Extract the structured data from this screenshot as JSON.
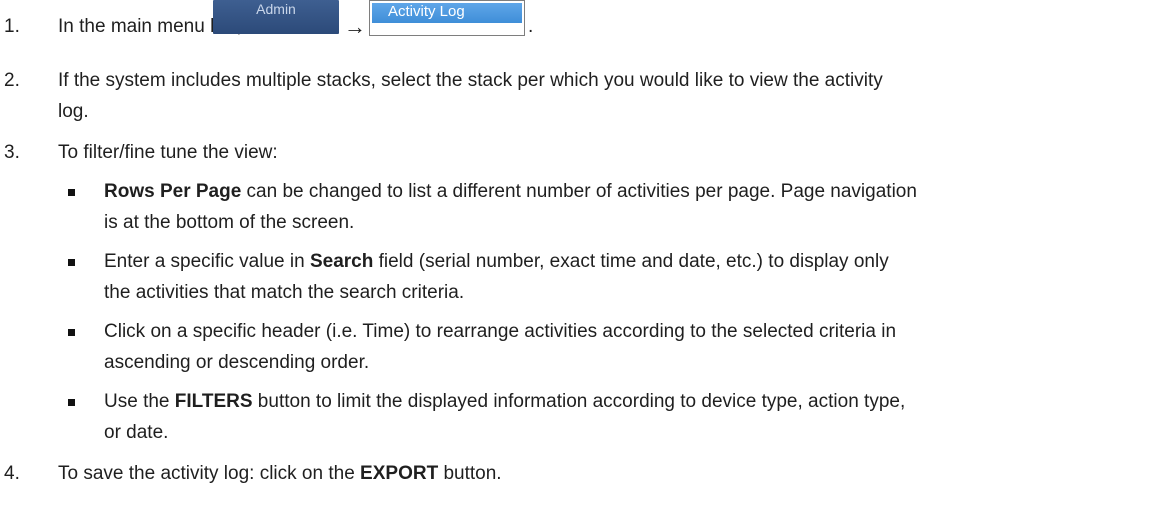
{
  "steps": [
    {
      "number": "1.",
      "text_before": "In the main menu bar, click",
      "admin_button": "Admin",
      "arrow": "→",
      "activity_button": "Activity Log",
      "trailing": "."
    },
    {
      "number": "2.",
      "line1": "If the system includes multiple stacks, select the stack per which you would like to view the activity",
      "line2": "log."
    },
    {
      "number": "3.",
      "text": "To filter/fine tune the view:",
      "bullets": [
        {
          "bold": "Rows Per Page",
          "line1": " can be changed to list a different number of activities per page. Page navigation",
          "line2": "is at the bottom of the screen."
        },
        {
          "pre": "Enter a specific value in ",
          "bold": "Search",
          "line1": " field (serial number, exact time and date, etc.) to display only",
          "line2": "the activities that match the search criteria."
        },
        {
          "line1": "Click on a specific header (i.e. Time) to rearrange activities according to the selected criteria in",
          "line2": "ascending or descending order."
        },
        {
          "pre": "Use the ",
          "bold": "FILTERS",
          "line1": " button to limit the displayed information according to device type, action type,",
          "line2": "or date."
        }
      ]
    },
    {
      "number": "4.",
      "pre": "To save the activity log: click on the ",
      "bold": "EXPORT",
      "post": " button."
    }
  ]
}
